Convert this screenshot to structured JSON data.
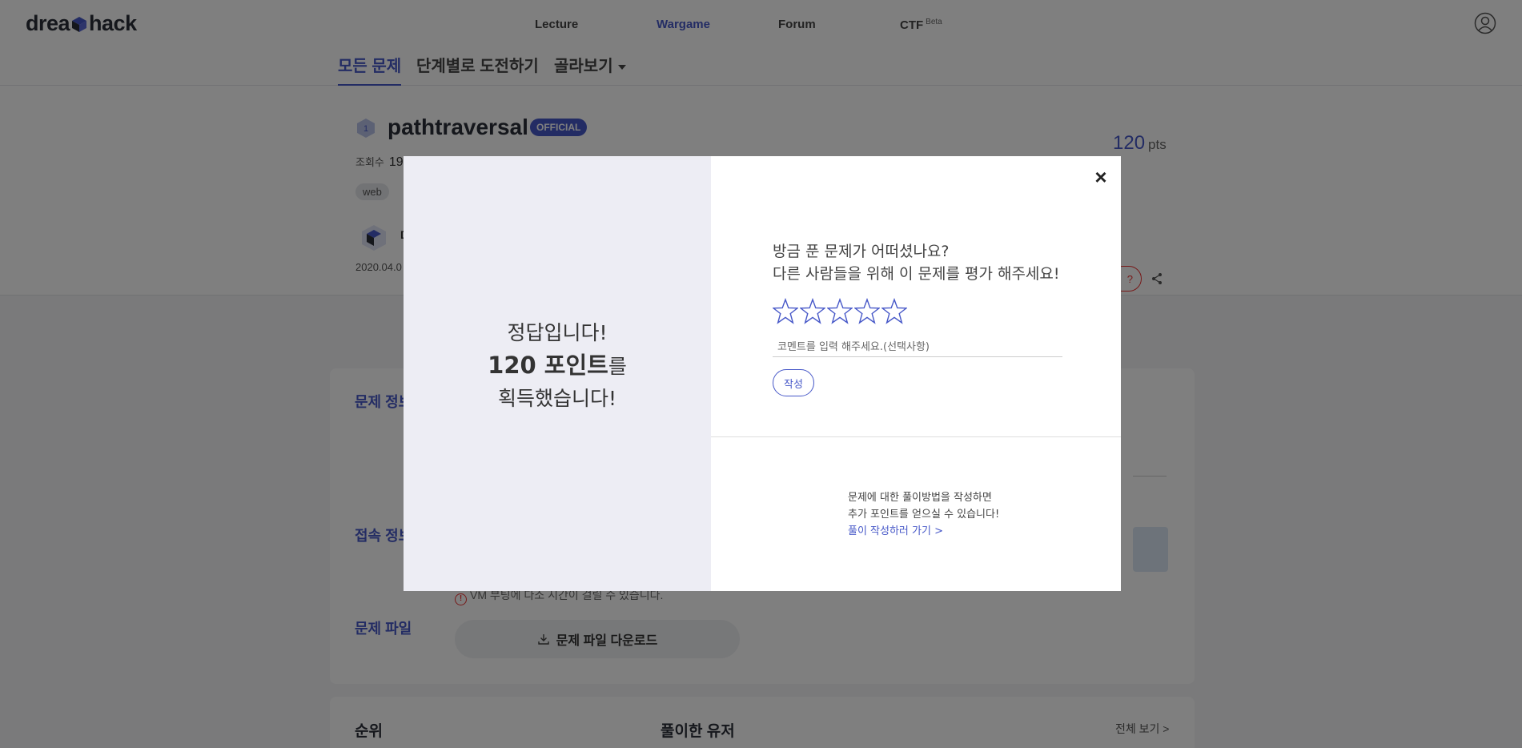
{
  "brand": {
    "logo_text_left": "drea",
    "logo_text_right": "hack",
    "accent": "#4758c8"
  },
  "nav": {
    "links": [
      {
        "label": "Lecture"
      },
      {
        "label": "Wargame"
      },
      {
        "label": "Forum"
      },
      {
        "label": "CTF"
      }
    ],
    "ctf_badge": "Beta",
    "active": "Wargame"
  },
  "subtabs": {
    "all": "모든 문제",
    "by_level": "단계별로 도전하기",
    "browse": "골라보기"
  },
  "challenge": {
    "level": "1",
    "title": "pathtraversal",
    "official_badge": "OFFICIAL",
    "views_label": "조회수",
    "views_value": "19",
    "tag": "web",
    "author_initial": "D",
    "date": "2020.04.0",
    "points": "120",
    "points_unit": "pts",
    "question_button": "?"
  },
  "sections": {
    "info": "문제 정보",
    "access": "접속 정보",
    "file": "문제 파일",
    "vm_note": "VM 부팅에 다소 시간이 걸릴 수 있습니다.",
    "download": "문제 파일 다운로드",
    "rank": "순위",
    "solvers": "풀이한 유저",
    "view_all": "전체 보기 >"
  },
  "modal": {
    "line1": "정답입니다!",
    "points_text": "120 포인트",
    "points_suffix": "를",
    "line3": "획득했습니다!",
    "rate_line1": "방금 푼 문제가 어떠셨나요?",
    "rate_line2": "다른 사람들을 위해 이 문제를 평가 해주세요!",
    "star_count": 5,
    "rating": 0,
    "comment_placeholder": "코멘트를 입력 해주세요.(선택사항)",
    "submit": "작성",
    "writeup_line1": "문제에 대한 풀이방법을 작성하면",
    "writeup_line2": "추가 포인트를 얻으실 수 있습니다!",
    "writeup_link": "풀이 작성하러 가기 >",
    "close_icon": "close-icon"
  }
}
